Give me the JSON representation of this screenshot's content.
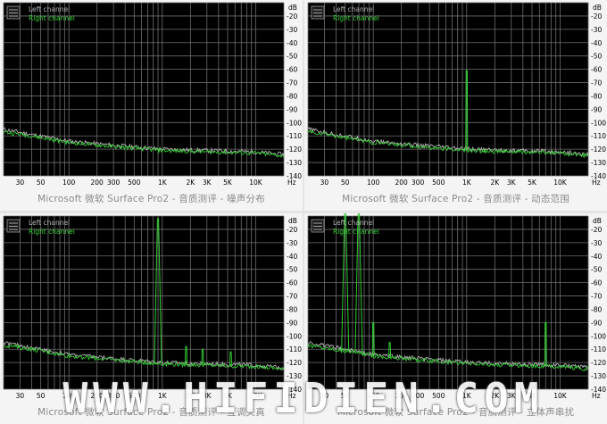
{
  "captions": [
    "Microsoft 微软 Surface Pro2 - 音质测评 - 噪声分布",
    "Microsoft 微软 Surface Pro2 - 音质测评 - 动态范围",
    "Microsoft 微软 Surface Pro2 - 音质测评 - 互调失真",
    "Microsoft 微软 Surface Pro2 - 音质测评 - 立体声串扰"
  ],
  "watermark": "WWW.HIFIDIEN.COM",
  "colors": {
    "plot_bg": "#000000",
    "grid": "#6e6e6e",
    "left_channel": "#b4b4b4",
    "right_channel": "#33cc33",
    "axis_text": "#000000"
  },
  "chart_data": [
    {
      "type": "line",
      "ylabel_unit": "dB",
      "xlabel_unit": "Hz",
      "xscale": "log",
      "xlim": [
        20,
        20000
      ],
      "ylim": [
        -140,
        -10
      ],
      "xticks": [
        "30",
        "50",
        "100",
        "200",
        "300",
        "500",
        "1K",
        "2K",
        "3K",
        "5K",
        "10K"
      ],
      "yticks": [
        "-20",
        "-30",
        "-40",
        "-50",
        "-60",
        "-70",
        "-80",
        "-90",
        "-100",
        "-110",
        "-120",
        "-130",
        "-140"
      ],
      "grid": true,
      "legend_position": "top-left",
      "series": [
        {
          "name": "Left channel",
          "x": [
            20,
            40,
            100,
            300,
            1000,
            3000,
            10000,
            20000
          ],
          "y": [
            -105,
            -109,
            -114,
            -117,
            -120,
            -121,
            -122,
            -124
          ]
        },
        {
          "name": "Right channel",
          "x": [
            20,
            40,
            100,
            300,
            1000,
            3000,
            10000,
            20000
          ],
          "y": [
            -107,
            -110,
            -115,
            -118,
            -121,
            -122,
            -123,
            -125
          ]
        }
      ]
    },
    {
      "type": "line",
      "ylabel_unit": "dB",
      "xlabel_unit": "Hz",
      "xscale": "log",
      "xlim": [
        20,
        20000
      ],
      "ylim": [
        -140,
        -10
      ],
      "xticks": [
        "30",
        "50",
        "100",
        "200",
        "300",
        "500",
        "1K",
        "2K",
        "3K",
        "5K",
        "10K"
      ],
      "yticks": [
        "-20",
        "-30",
        "-40",
        "-50",
        "-60",
        "-70",
        "-80",
        "-90",
        "-100",
        "-110",
        "-120",
        "-130",
        "-140"
      ],
      "grid": true,
      "legend_position": "top-left",
      "series": [
        {
          "name": "Left channel",
          "x": [
            20,
            40,
            100,
            300,
            1000,
            3000,
            10000,
            20000
          ],
          "y": [
            -105,
            -109,
            -114,
            -117,
            -120,
            -121,
            -122,
            -124
          ]
        },
        {
          "name": "Right channel",
          "x": [
            20,
            40,
            100,
            300,
            1000,
            3000,
            10000,
            20000
          ],
          "y": [
            -107,
            -110,
            -115,
            -118,
            -121,
            -122,
            -123,
            -125
          ],
          "peaks": [
            {
              "x": 1000,
              "y": -61
            }
          ]
        }
      ]
    },
    {
      "type": "line",
      "ylabel_unit": "dB",
      "xlabel_unit": "Hz",
      "xscale": "log",
      "xlim": [
        20,
        20000
      ],
      "ylim": [
        -140,
        -10
      ],
      "xticks": [
        "30",
        "50",
        "100",
        "200",
        "300",
        "500",
        "1K",
        "2K",
        "3K",
        "5K",
        "10K"
      ],
      "yticks": [
        "-20",
        "-30",
        "-40",
        "-50",
        "-60",
        "-70",
        "-80",
        "-90",
        "-100",
        "-110",
        "-120",
        "-130",
        "-140"
      ],
      "grid": true,
      "legend_position": "top-left",
      "series": [
        {
          "name": "Left channel",
          "x": [
            20,
            40,
            100,
            300,
            1000,
            3000,
            10000,
            20000
          ],
          "y": [
            -105,
            -109,
            -114,
            -117,
            -120,
            -121,
            -122,
            -124
          ]
        },
        {
          "name": "Right channel",
          "x": [
            20,
            40,
            100,
            300,
            1000,
            3000,
            10000,
            20000
          ],
          "y": [
            -107,
            -110,
            -115,
            -118,
            -121,
            -122,
            -123,
            -125
          ],
          "peaks": [
            {
              "x": 900,
              "y": -12
            },
            {
              "x": 1800,
              "y": -108
            },
            {
              "x": 2700,
              "y": -110
            },
            {
              "x": 5400,
              "y": -112
            }
          ]
        }
      ]
    },
    {
      "type": "line",
      "ylabel_unit": "dB",
      "xlabel_unit": "Hz",
      "xscale": "log",
      "xlim": [
        20,
        20000
      ],
      "ylim": [
        -140,
        -10
      ],
      "xticks": [
        "30",
        "50",
        "100",
        "200",
        "300",
        "500",
        "1K",
        "2K",
        "3K",
        "5K",
        "10K"
      ],
      "yticks": [
        "-20",
        "-30",
        "-40",
        "-50",
        "-60",
        "-70",
        "-80",
        "-90",
        "-100",
        "-110",
        "-120",
        "-130",
        "-140"
      ],
      "grid": true,
      "legend_position": "top-left",
      "series": [
        {
          "name": "Left channel",
          "x": [
            20,
            40,
            100,
            300,
            1000,
            3000,
            10000,
            20000
          ],
          "y": [
            -105,
            -109,
            -114,
            -117,
            -120,
            -121,
            -122,
            -124
          ]
        },
        {
          "name": "Right channel",
          "x": [
            20,
            40,
            100,
            300,
            1000,
            3000,
            10000,
            20000
          ],
          "y": [
            -107,
            -110,
            -115,
            -118,
            -121,
            -122,
            -123,
            -125
          ],
          "peaks": [
            {
              "x": 50,
              "y": -5
            },
            {
              "x": 70,
              "y": -5
            },
            {
              "x": 100,
              "y": -90
            },
            {
              "x": 150,
              "y": -105
            },
            {
              "x": 7000,
              "y": -90
            }
          ]
        }
      ]
    }
  ]
}
